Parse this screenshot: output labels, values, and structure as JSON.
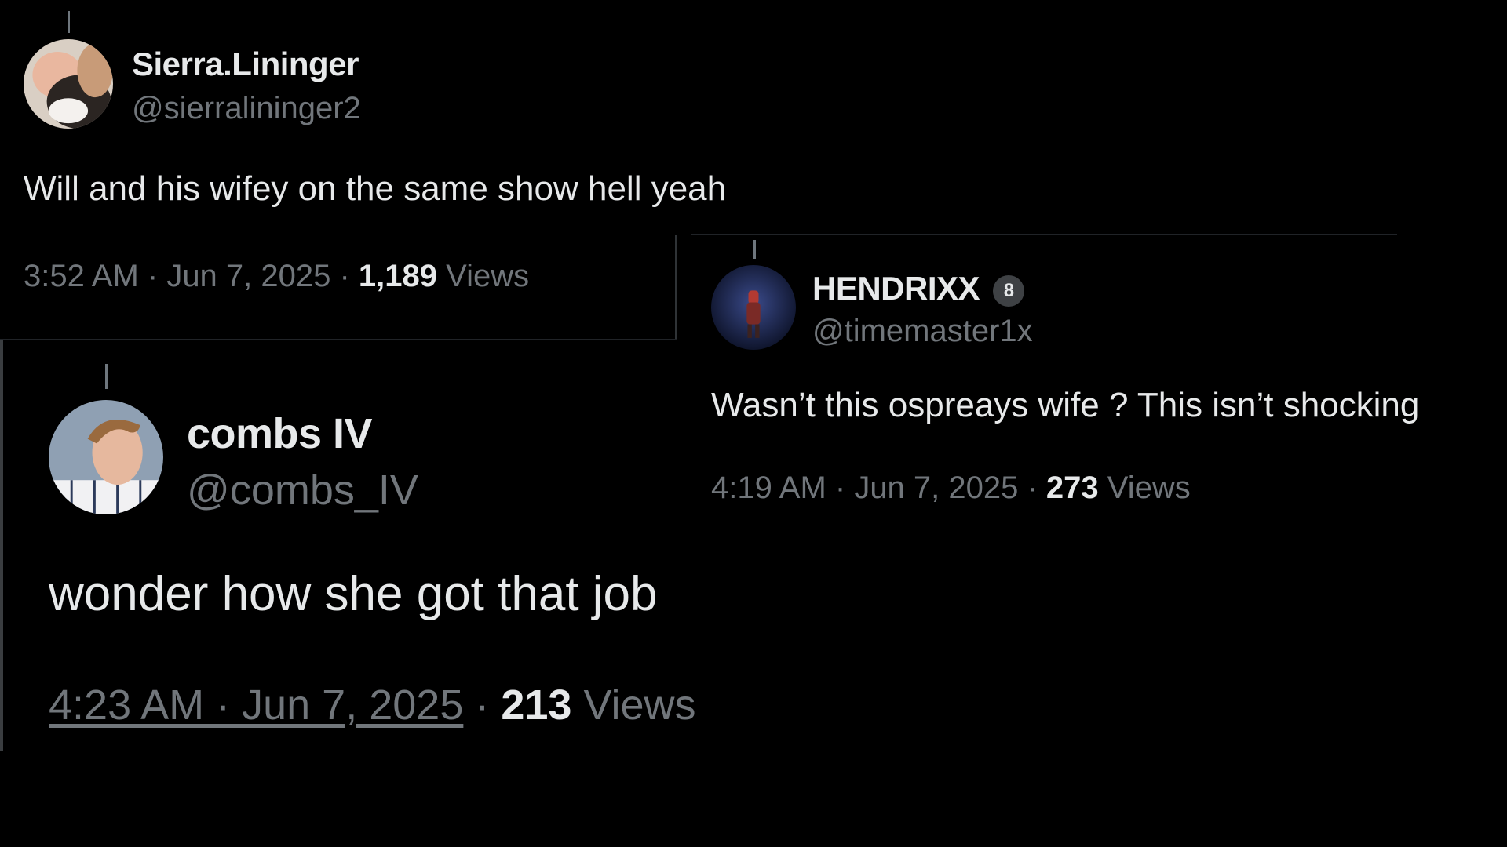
{
  "tweets": [
    {
      "name": "Sierra.Lininger",
      "handle": "@sierralininger2",
      "text": "Will and his wifey on the same show hell yeah",
      "time": "3:52 AM",
      "sep1": " · ",
      "date": "Jun 7, 2025",
      "sep2": " · ",
      "views_count": "1,189",
      "views_label": " Views",
      "avatar_icon": "avatar-photo"
    },
    {
      "name": "HENDRIXX",
      "badge": "8",
      "handle": "@timemaster1x",
      "text": "Wasn’t this ospreays wife ? This isn’t shocking",
      "time": "4:19 AM",
      "sep1": " · ",
      "date": "Jun 7, 2025",
      "sep2": " · ",
      "views_count": "273",
      "views_label": " Views",
      "avatar_icon": "avatar-photo"
    },
    {
      "name": "combs IV",
      "handle": "@combs_IV",
      "text": "wonder how she got that job",
      "time": "4:23 AM · Jun 7, 2025",
      "sep2": " · ",
      "views_count": "213",
      "views_label": " Views",
      "avatar_icon": "avatar-photo"
    }
  ],
  "colors": {
    "background": "#000000",
    "primary_text": "#e7e9ea",
    "secondary_text": "#71767b",
    "divider": "#2f3336"
  }
}
